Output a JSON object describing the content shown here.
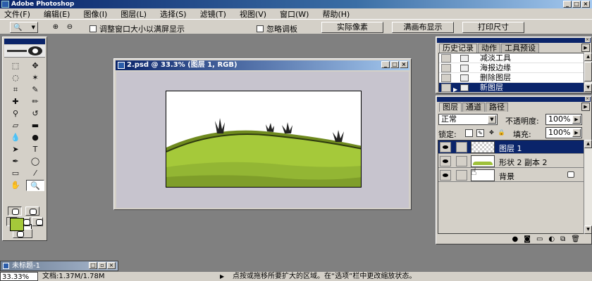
{
  "app": {
    "title": "Adobe Photoshop"
  },
  "menu": [
    "文件(F)",
    "编辑(E)",
    "图像(I)",
    "图层(L)",
    "选择(S)",
    "滤镜(T)",
    "视图(V)",
    "窗口(W)",
    "帮助(H)"
  ],
  "options": {
    "fit_window_label": "调整窗口大小以满屏显示",
    "ignore_palettes_label": "忽略调板",
    "actual_pixels": "实际像素",
    "fit_on_screen": "满画布显示",
    "print_size": "打印尺寸"
  },
  "document": {
    "title": "2.psd @ 33.3% (图层 1, RGB)",
    "colors": {
      "grass": "#a5c93a",
      "grass_dark": "#6f8a1e",
      "canvas_bg": "#c7c4ce"
    }
  },
  "minimized_doc": {
    "title": "未标题-1"
  },
  "status": {
    "zoom": "33.33%",
    "doc_info": "文档:1.37M/1.78M",
    "hint": "点按或拖移所要扩大的区域。在“选项”栏中更改缩放状态。"
  },
  "history_palette": {
    "tabs": [
      "历史记录",
      "动作",
      "工具预设"
    ],
    "items": [
      {
        "label": "减淡工具",
        "selected": false
      },
      {
        "label": "海报边缘",
        "selected": false
      },
      {
        "label": "删除图层",
        "selected": false
      },
      {
        "label": "新图层",
        "selected": true
      }
    ]
  },
  "layers_palette": {
    "tabs": [
      "图层",
      "通道",
      "路径"
    ],
    "blend_mode": "正常",
    "opacity_label": "不透明度:",
    "opacity_value": "100%",
    "lock_label": "锁定:",
    "fill_label": "填充:",
    "fill_value": "100%",
    "layers": [
      {
        "name": "图层 1",
        "selected": true
      },
      {
        "name": "形状 2 副本 2",
        "selected": false
      },
      {
        "name": "背景",
        "selected": false,
        "locked": true
      }
    ]
  },
  "toolbox": {
    "foreground_color": "#a5c93a",
    "background_color": "#ffffff"
  }
}
